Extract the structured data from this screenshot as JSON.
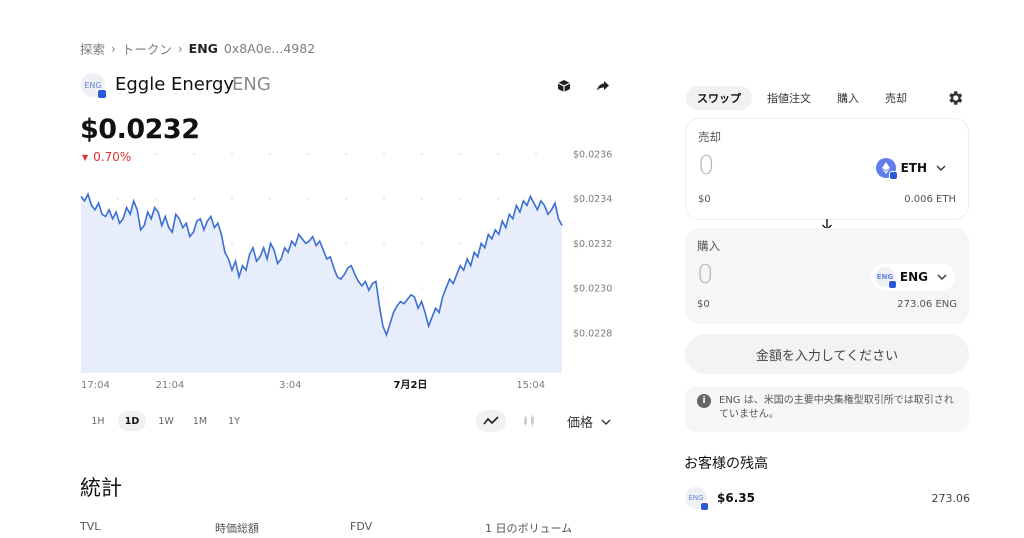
{
  "breadcrumb": {
    "explore": "探索",
    "tokens": "トークン",
    "current": "ENG",
    "address": "0x8A0e...4982"
  },
  "token": {
    "logo_text": "ENG",
    "name": "Eggle Energy",
    "symbol": "ENG",
    "price": "$0.0232",
    "change": "0.70%",
    "change_direction": "down",
    "change_color": "#e0312f"
  },
  "header_icons": [
    "cube-icon",
    "share-icon"
  ],
  "chart_data": {
    "type": "area",
    "series_color": "#3b6fd4",
    "fill_color": "#e8edfb",
    "x_ticks": [
      "17:04",
      "21:04",
      "3:04",
      "7月2日",
      "15:04"
    ],
    "y_ticks": [
      "$0.0236",
      "$0.0234",
      "$0.0232",
      "$0.0230",
      "$0.0228"
    ],
    "ylim": [
      0.02262,
      0.02364
    ],
    "values": [
      0.02341,
      0.02339,
      0.02342,
      0.02337,
      0.02335,
      0.02338,
      0.02333,
      0.02332,
      0.02335,
      0.02331,
      0.02334,
      0.02329,
      0.02331,
      0.02336,
      0.02333,
      0.02339,
      0.02335,
      0.02326,
      0.02328,
      0.02334,
      0.02331,
      0.02336,
      0.02334,
      0.02328,
      0.02332,
      0.02327,
      0.02325,
      0.02333,
      0.02331,
      0.02327,
      0.02329,
      0.02323,
      0.02325,
      0.0233,
      0.02331,
      0.02326,
      0.0233,
      0.02332,
      0.02327,
      0.02329,
      0.02324,
      0.02316,
      0.02313,
      0.02308,
      0.02312,
      0.02305,
      0.0231,
      0.02308,
      0.02315,
      0.02318,
      0.02312,
      0.02314,
      0.02318,
      0.02313,
      0.0232,
      0.02317,
      0.02311,
      0.02313,
      0.02318,
      0.02316,
      0.02321,
      0.02319,
      0.02324,
      0.02322,
      0.0232,
      0.02321,
      0.02323,
      0.02319,
      0.02321,
      0.02317,
      0.02313,
      0.02314,
      0.02309,
      0.02305,
      0.02304,
      0.02306,
      0.02309,
      0.0231,
      0.02306,
      0.02303,
      0.02301,
      0.02303,
      0.02299,
      0.02302,
      0.02303,
      0.02292,
      0.02283,
      0.02279,
      0.02284,
      0.02289,
      0.02292,
      0.02294,
      0.02293,
      0.02295,
      0.02297,
      0.02296,
      0.02291,
      0.02294,
      0.02289,
      0.02283,
      0.02287,
      0.02291,
      0.02289,
      0.02296,
      0.023,
      0.02304,
      0.02302,
      0.02306,
      0.0231,
      0.02308,
      0.02313,
      0.0231,
      0.02316,
      0.02314,
      0.0232,
      0.02318,
      0.02324,
      0.02322,
      0.02326,
      0.02324,
      0.0233,
      0.02327,
      0.02333,
      0.02331,
      0.02337,
      0.02334,
      0.02339,
      0.02337,
      0.02341,
      0.02338,
      0.02335,
      0.02339,
      0.02337,
      0.02333,
      0.02335,
      0.02338,
      0.02331,
      0.02328
    ]
  },
  "ranges": [
    "1H",
    "1D",
    "1W",
    "1M",
    "1Y"
  ],
  "active_range": "1D",
  "metric": "価格",
  "stats": {
    "title": "統計",
    "labels": [
      "TVL",
      "時価総額",
      "FDV",
      "1 日のボリューム"
    ]
  },
  "swap": {
    "tabs": [
      "スワップ",
      "指値注文",
      "購入",
      "売却"
    ],
    "active_tab": "スワップ",
    "sell": {
      "label": "売却",
      "amount": "0",
      "token": "ETH",
      "usd": "$0",
      "balance": "0.006 ETH"
    },
    "buy": {
      "label": "購入",
      "amount": "0",
      "token": "ENG",
      "token_logo_text": "ENG",
      "usd": "$0",
      "balance": "273.06 ENG"
    },
    "submit_label": "金額を入力してください",
    "warning": "ENG は、米国の主要中央集権型取引所では取引されていません。"
  },
  "balance": {
    "title": "お客様の残高",
    "token_logo_text": "ENG",
    "usd": "$6.35",
    "amount": "273.06"
  }
}
